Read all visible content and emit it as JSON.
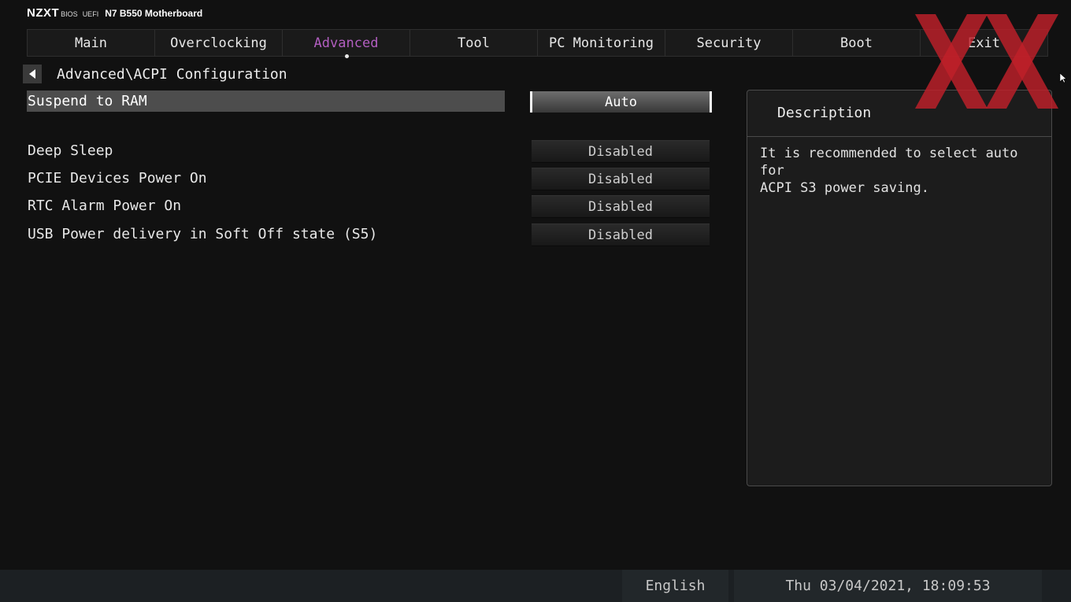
{
  "brand": {
    "logo": "NZXT",
    "bios": "BIOS",
    "uefi": "UEFI",
    "model": "N7 B550 Motherboard"
  },
  "tabs": [
    {
      "label": "Main",
      "active": false
    },
    {
      "label": "Overclocking",
      "active": false
    },
    {
      "label": "Advanced",
      "active": true
    },
    {
      "label": "Tool",
      "active": false
    },
    {
      "label": "PC Monitoring",
      "active": false
    },
    {
      "label": "Security",
      "active": false
    },
    {
      "label": "Boot",
      "active": false
    },
    {
      "label": "Exit",
      "active": false
    }
  ],
  "breadcrumb": "Advanced\\ACPI Configuration",
  "settings": [
    {
      "label": "Suspend to RAM",
      "value": "Auto",
      "selected": true
    },
    {
      "label": "Deep Sleep",
      "value": "Disabled",
      "selected": false
    },
    {
      "label": "PCIE Devices Power On",
      "value": "Disabled",
      "selected": false
    },
    {
      "label": "RTC Alarm Power On",
      "value": "Disabled",
      "selected": false
    },
    {
      "label": "USB Power delivery in Soft Off state (S5)",
      "value": "Disabled",
      "selected": false
    }
  ],
  "description": {
    "title": "Description",
    "line1": "It is recommended to select auto for",
    "line2": "ACPI S3 power saving."
  },
  "status_bar": {
    "language": "English",
    "datetime": "Thu 03/04/2021, 18:09:53"
  },
  "colors": {
    "active_tab": "#b25ec0",
    "watermark": "#c0202a"
  },
  "icons": {
    "back": "back-arrow-icon",
    "watermark": "watermark-logo",
    "cursor": "mouse-cursor-icon"
  }
}
